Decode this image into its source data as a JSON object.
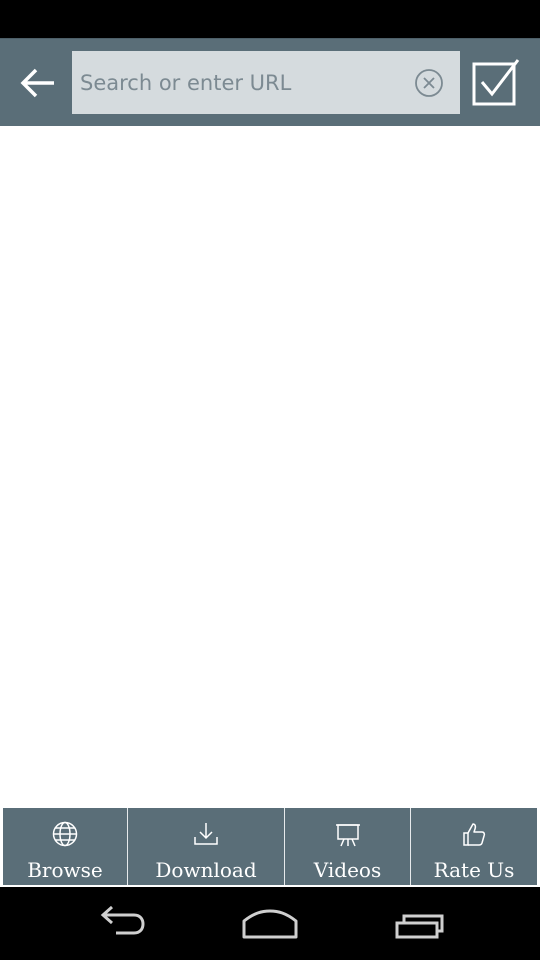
{
  "search": {
    "placeholder": "Search or enter URL",
    "value": ""
  },
  "icons": {
    "back": "arrow-left-icon",
    "clear": "clear-circle-icon",
    "go": "checkbox-checked-icon"
  },
  "tabs": [
    {
      "label": "Browse",
      "icon": "globe-icon"
    },
    {
      "label": "Download",
      "icon": "download-icon"
    },
    {
      "label": "Videos",
      "icon": "video-screen-icon"
    },
    {
      "label": "Rate Us",
      "icon": "thumbs-up-icon"
    }
  ],
  "nav": {
    "back": "nav-back-icon",
    "home": "nav-home-icon",
    "recents": "nav-recents-icon"
  },
  "colors": {
    "toolbar": "#5a6e78",
    "search_box": "#d5dbde",
    "content": "#ffffff",
    "tab_text": "#ffffff"
  }
}
